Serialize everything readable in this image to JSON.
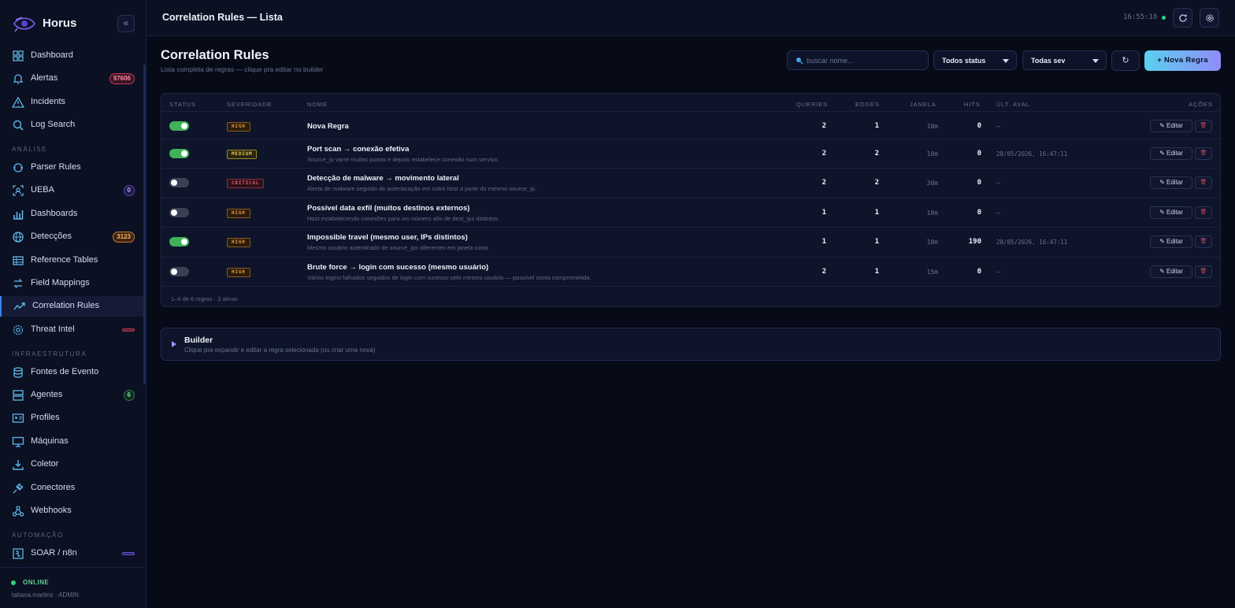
{
  "brand": {
    "name": "Horus",
    "collapse_glyph": "«"
  },
  "sidebar": {
    "items": [
      {
        "label": "Dashboard",
        "icon": "grid-icon",
        "name": "sidebar-item-dashboard"
      },
      {
        "label": "Alertas",
        "icon": "bell-icon",
        "badge": "97606",
        "badge_style": "red",
        "name": "sidebar-item-alertas"
      },
      {
        "label": "Incidents",
        "icon": "warning-icon",
        "name": "sidebar-item-incidents"
      },
      {
        "label": "Log Search",
        "icon": "search-icon",
        "name": "sidebar-item-log-search"
      },
      {
        "label": "Parser Rules",
        "icon": "parser-icon",
        "name": "sidebar-item-parser-rules"
      },
      {
        "label": "UEBA",
        "icon": "user-scan-icon",
        "badge": "0",
        "badge_style": "purple",
        "name": "sidebar-item-ueba"
      },
      {
        "label": "Dashboards",
        "icon": "bar-chart-icon",
        "name": "sidebar-item-dashboards"
      },
      {
        "label": "Detecções",
        "icon": "globe-icon",
        "badge": "3123",
        "badge_style": "orange",
        "name": "sidebar-item-deteccoes"
      },
      {
        "label": "Reference Tables",
        "icon": "table-icon",
        "name": "sidebar-item-reference-tables"
      },
      {
        "label": "Field Mappings",
        "icon": "swap-icon",
        "name": "sidebar-item-field-mappings"
      },
      {
        "label": "Correlation Rules",
        "icon": "trend-icon",
        "active": true,
        "name": "sidebar-item-correlation-rules"
      },
      {
        "label": "Threat Intel",
        "icon": "gear-shield-icon",
        "bar": "red",
        "name": "sidebar-item-threat-intel"
      },
      {
        "label": "Fontes de Evento",
        "icon": "database-icon",
        "name": "sidebar-item-fontes-de-evento"
      },
      {
        "label": "Agentes",
        "icon": "server-icon",
        "badge": "6",
        "badge_style": "green",
        "name": "sidebar-item-agentes"
      },
      {
        "label": "Profiles",
        "icon": "id-card-icon",
        "name": "sidebar-item-profiles"
      },
      {
        "label": "Máquinas",
        "icon": "monitor-icon",
        "name": "sidebar-item-maquinas"
      },
      {
        "label": "Coletor",
        "icon": "download-icon",
        "name": "sidebar-item-coletor"
      },
      {
        "label": "Conectores",
        "icon": "plug-icon",
        "name": "sidebar-item-conectores"
      },
      {
        "label": "Webhooks",
        "icon": "webhook-icon",
        "name": "sidebar-item-webhooks"
      },
      {
        "label": "SOAR / n8n",
        "icon": "workflow-icon",
        "bar": "purple",
        "name": "sidebar-item-soar"
      }
    ],
    "sections": [
      "ANÁLISE",
      "INFRAESTRUTURA",
      "AUTOMAÇÃO"
    ],
    "status": "ONLINE",
    "user": "tatiana.martins · ADMIN"
  },
  "header": {
    "title": "Correlation Rules — Lista",
    "clock": "16:55:18"
  },
  "main": {
    "title": "Correlation Rules",
    "subtitle": "Lista completa de regras — clique pra editar no builder",
    "search_placeholder": "buscar nome...",
    "status_filter": "Todos status",
    "severity_filter": "Todas sev",
    "refresh_glyph": "↻",
    "new_button": "+ Nova Regra"
  },
  "table": {
    "headers": {
      "status": "STATUS",
      "severity": "SEVERIDADE",
      "name": "NOME",
      "queries": "QUERIES",
      "edges": "EDGES",
      "window": "JANELA",
      "hits": "HITS",
      "last": "ÚLT. AVAL",
      "actions": "AÇÕES"
    },
    "edit_label": "✎ Editar",
    "delete_glyph": "🗑",
    "rows": [
      {
        "enabled": true,
        "severity": "HIGH",
        "name": "Nova Regra",
        "desc": "",
        "queries": "2",
        "edges": "1",
        "window": "10m",
        "hits": "0",
        "last": "—"
      },
      {
        "enabled": true,
        "severity": "MEDIUM",
        "name": "Port scan → conexão efetiva",
        "desc": "Source_ip varre muitas portas e depois estabelece conexão num serviço.",
        "queries": "2",
        "edges": "2",
        "window": "10m",
        "hits": "0",
        "last": "28/05/2026, 16:47:11"
      },
      {
        "enabled": false,
        "severity": "CRITICAL",
        "name": "Detecção de malware → movimento lateral",
        "desc": "Alerta de malware seguido de autenticação em outro host a partir do mesmo source_ip.",
        "queries": "2",
        "edges": "2",
        "window": "30m",
        "hits": "0",
        "last": "—"
      },
      {
        "enabled": false,
        "severity": "HIGH",
        "name": "Possível data exfil (muitos destinos externos)",
        "desc": "Host estabelecendo conexões para um número alto de dest_ips distintos.",
        "queries": "1",
        "edges": "1",
        "window": "10m",
        "hits": "0",
        "last": "—"
      },
      {
        "enabled": true,
        "severity": "HIGH",
        "name": "Impossible travel (mesmo user, IPs distintos)",
        "desc": "Mesmo usuário autenticado de source_ips diferentes em janela curta.",
        "queries": "1",
        "edges": "1",
        "window": "10m",
        "hits": "190",
        "last": "28/05/2026, 16:47:11"
      },
      {
        "enabled": false,
        "severity": "HIGH",
        "name": "Brute force → login com sucesso (mesmo usuário)",
        "desc": "Vários logins falhados seguidos de login com sucesso pelo mesmo usuário — possível conta comprometida.",
        "queries": "2",
        "edges": "1",
        "window": "15m",
        "hits": "0",
        "last": "—"
      }
    ],
    "footer": "1–6 de 6 regras · 3 ativas"
  },
  "builder": {
    "title": "Builder",
    "subtitle": "Clique pra expandir e editar a regra selecionada (ou criar uma nova)"
  },
  "colors": {
    "accent": "#3b82f6",
    "success": "#3fb25a",
    "danger": "#e45a72"
  }
}
